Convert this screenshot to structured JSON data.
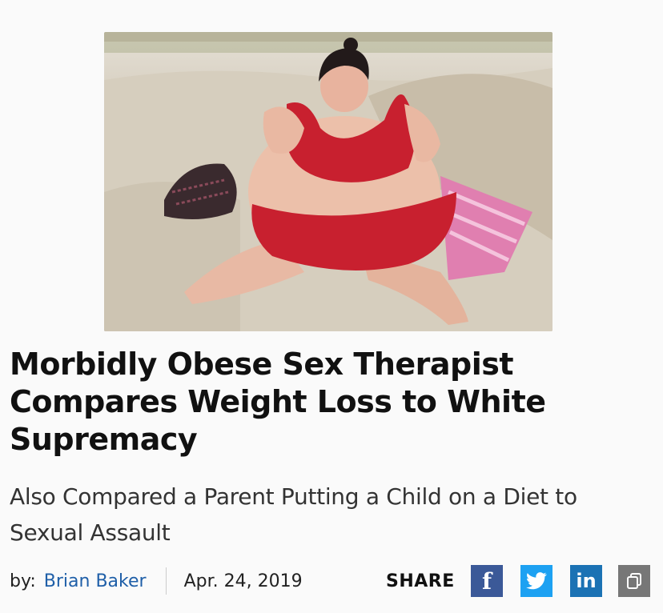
{
  "article": {
    "headline": "Morbidly Obese Sex Therapist Compares Weight Loss to White Supremacy",
    "subheadline": "Also Compared a Parent Putting a Child on a Diet to Sexual Assault",
    "hero_image_alt": "Photo of a woman in a red swimsuit sitting on beach sand"
  },
  "byline": {
    "prefix": "by:",
    "author": "Brian Baker",
    "date": "Apr. 24, 2019"
  },
  "share": {
    "label": "SHARE",
    "facebook": "f",
    "linkedin": "in",
    "icons": [
      "facebook-icon",
      "twitter-icon",
      "linkedin-icon",
      "copy-link-icon"
    ]
  },
  "colors": {
    "author_link": "#1f5fa8",
    "facebook": "#3b5998",
    "twitter": "#1da1f2",
    "linkedin": "#1b72b4",
    "copy": "#777777"
  }
}
